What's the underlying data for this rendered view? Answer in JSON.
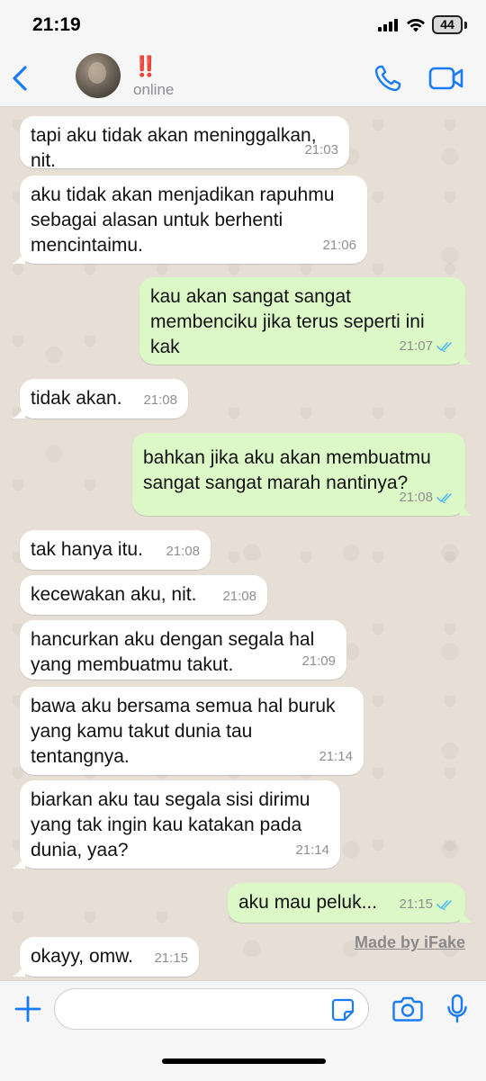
{
  "status_bar": {
    "time": "21:19",
    "battery": "44"
  },
  "header": {
    "name": "‼️",
    "status": "online"
  },
  "messages": [
    {
      "dir": "in",
      "text": "tapi aku tidak akan meninggalkan,\nnit.",
      "time": "21:03"
    },
    {
      "dir": "in",
      "text": "aku tidak akan menjadikan rapuhmu\nsebagai alasan untuk berhenti\nmencintaimu.",
      "time": "21:06"
    },
    {
      "dir": "out",
      "text": "kau akan sangat sangat\nmembenciku jika terus seperti ini\nkak",
      "time": "21:07"
    },
    {
      "dir": "in",
      "text": "tidak akan.",
      "time": "21:08"
    },
    {
      "dir": "out",
      "text": "bahkan jika aku akan membuatmu\nsangat sangat marah nantinya?",
      "time": "21:08"
    },
    {
      "dir": "in",
      "text": "tak hanya itu.",
      "time": "21:08"
    },
    {
      "dir": "in",
      "text": "kecewakan aku, nit.",
      "time": "21:08"
    },
    {
      "dir": "in",
      "text": "hancurkan aku dengan segala hal\nyang membuatmu takut.",
      "time": "21:09"
    },
    {
      "dir": "in",
      "text": "bawa aku bersama semua hal buruk\nyang kamu takut dunia tau\ntentangnya.",
      "time": "21:14"
    },
    {
      "dir": "in",
      "text": "biarkan aku tau segala sisi dirimu\nyang tak ingin kau katakan pada\ndunia, yaa?",
      "time": "21:14"
    },
    {
      "dir": "out",
      "text": "aku mau peluk...",
      "time": "21:15"
    },
    {
      "dir": "in",
      "text": "okayy, omw.",
      "time": "21:15"
    }
  ],
  "watermark": "Made by iFake",
  "colors": {
    "accent": "#1a7cf5",
    "outgoing_bubble": "#dcf8c6",
    "incoming_bubble": "#ffffff",
    "read_ticks": "#53bdeb"
  },
  "icons": [
    "back-chevron-icon",
    "phone-icon",
    "video-camera-icon",
    "plus-icon",
    "sticker-icon",
    "camera-icon",
    "microphone-icon",
    "double-check-icon"
  ]
}
